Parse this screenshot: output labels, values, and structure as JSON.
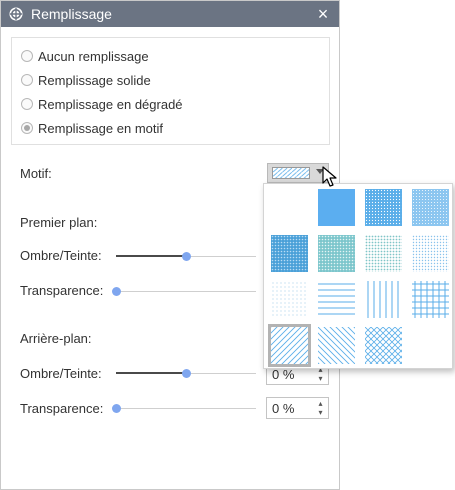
{
  "window": {
    "title": "Remplissage",
    "close_icon": "close-icon"
  },
  "fill_options": [
    {
      "label": "Aucun remplissage",
      "checked": false
    },
    {
      "label": "Remplissage solide",
      "checked": false
    },
    {
      "label": "Remplissage en dégradé",
      "checked": false
    },
    {
      "label": "Remplissage en motif",
      "checked": true
    }
  ],
  "motif": {
    "label": "Motif:",
    "selected_pattern": "diagonal-lines"
  },
  "foreground": {
    "section_label": "Premier plan:",
    "shade_label": "Ombre/Teinte:",
    "transparency_label": "Transparence:",
    "shade_level": 0.5,
    "transparency_level": 0.0
  },
  "background": {
    "section_label": "Arrière-plan:",
    "shade_label": "Ombre/Teinte:",
    "transparency_label": "Transparence:",
    "shade_level": 0.5,
    "transparency_level": 0.0,
    "shade_value": "0 %",
    "transparency_value": "0 %"
  },
  "pattern_grid": [
    "empty",
    "solid",
    "dots-dense",
    "dots-fine",
    "dots-medium",
    "dots-teal",
    "dots-sparse",
    "dots-very-sparse",
    "dots-tiny",
    "horizontal-lines",
    "vertical-lines",
    "grid",
    "diagonal-lines",
    "diagonal-lines-reverse",
    "crosshatch",
    "none"
  ],
  "colors": {
    "titlebar": "#6b7483",
    "accent": "#5baef0",
    "pattern": "#5aaee9",
    "slider_thumb": "#7fa6ef"
  }
}
